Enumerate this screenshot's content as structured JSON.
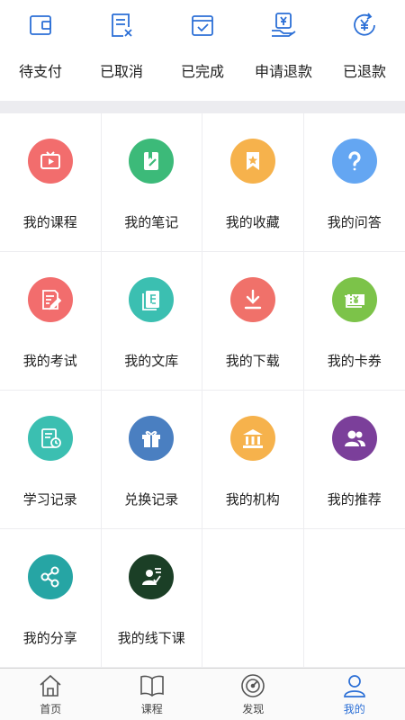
{
  "orders": [
    {
      "label": "待支付",
      "icon": "wallet-icon"
    },
    {
      "label": "已取消",
      "icon": "cancelled-doc-icon"
    },
    {
      "label": "已完成",
      "icon": "completed-calendar-icon"
    },
    {
      "label": "申请退款",
      "icon": "refund-request-icon"
    },
    {
      "label": "已退款",
      "icon": "refunded-yen-icon"
    }
  ],
  "grid": [
    {
      "label": "我的课程",
      "icon": "video-play-icon",
      "color": "#f26d6d"
    },
    {
      "label": "我的笔记",
      "icon": "notebook-pen-icon",
      "color": "#3cba79"
    },
    {
      "label": "我的收藏",
      "icon": "bookmark-star-icon",
      "color": "#f6b24c"
    },
    {
      "label": "我的问答",
      "icon": "question-icon",
      "color": "#64a6f2"
    },
    {
      "label": "我的考试",
      "icon": "exam-paper-icon",
      "color": "#f26d6d"
    },
    {
      "label": "我的文库",
      "icon": "library-book-icon",
      "color": "#3bbfb1"
    },
    {
      "label": "我的下载",
      "icon": "download-icon",
      "color": "#f0716a"
    },
    {
      "label": "我的卡券",
      "icon": "coupon-ticket-icon",
      "color": "#7cc349"
    },
    {
      "label": "学习记录",
      "icon": "study-record-icon",
      "color": "#3bbfb1"
    },
    {
      "label": "兑换记录",
      "icon": "gift-box-icon",
      "color": "#4a7fc1"
    },
    {
      "label": "我的机构",
      "icon": "institution-building-icon",
      "color": "#f6b24c"
    },
    {
      "label": "我的推荐",
      "icon": "users-group-icon",
      "color": "#7b3f9a"
    },
    {
      "label": "我的分享",
      "icon": "share-nodes-icon",
      "color": "#26a5a4"
    },
    {
      "label": "我的线下课",
      "icon": "offline-class-icon",
      "color": "#1b3f26"
    }
  ],
  "tabs": [
    {
      "label": "首页",
      "icon": "home-icon"
    },
    {
      "label": "课程",
      "icon": "book-icon"
    },
    {
      "label": "发现",
      "icon": "compass-icon"
    },
    {
      "label": "我的",
      "icon": "user-icon",
      "active": true
    }
  ],
  "colors": {
    "accent": "#2b6fd6",
    "order_icon": "#2b6fd6"
  }
}
